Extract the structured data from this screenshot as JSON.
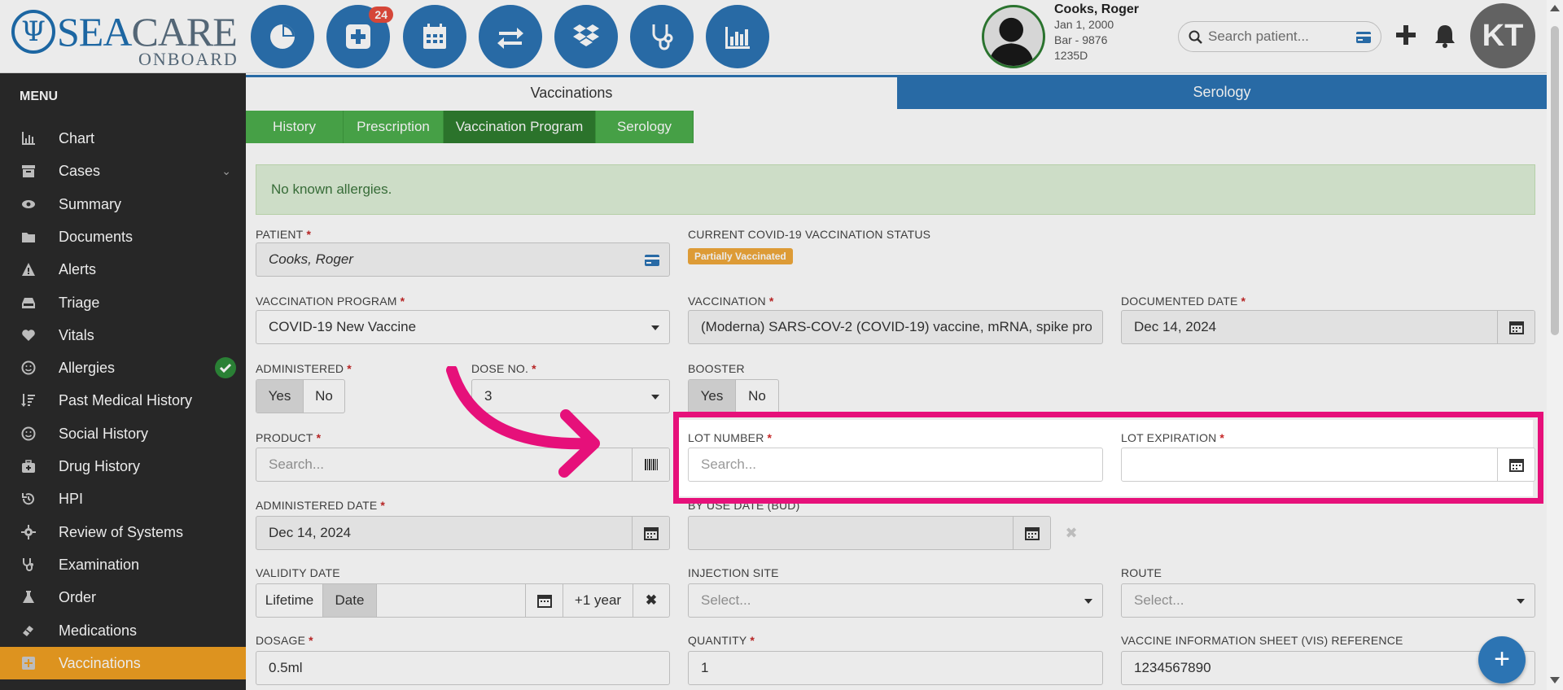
{
  "app": {
    "logo_main_a": "SEA",
    "logo_main_b": "CARE",
    "logo_sub": "ONBOARD",
    "notification_badge": "24",
    "search_placeholder": "Search patient...",
    "avatar_initials": "KT"
  },
  "patient": {
    "name": "Cooks, Roger",
    "dob": "Jan 1, 2000",
    "ident": "Bar - 9876",
    "room": "1235D"
  },
  "sidebar": {
    "title": "MENU",
    "items": [
      {
        "label": "Chart",
        "icon": "bar-chart-icon"
      },
      {
        "label": "Cases",
        "icon": "archive-icon"
      },
      {
        "label": "Summary",
        "icon": "eye-icon"
      },
      {
        "label": "Documents",
        "icon": "folder-icon"
      },
      {
        "label": "Alerts",
        "icon": "warning-icon"
      },
      {
        "label": "Triage",
        "icon": "inbox-icon"
      },
      {
        "label": "Vitals",
        "icon": "heart-icon"
      },
      {
        "label": "Allergies",
        "icon": "smile-icon"
      },
      {
        "label": "Past Medical History",
        "icon": "sort-icon"
      },
      {
        "label": "Social History",
        "icon": "smile-icon"
      },
      {
        "label": "Drug History",
        "icon": "medkit-icon"
      },
      {
        "label": "HPI",
        "icon": "history-icon"
      },
      {
        "label": "Review of Systems",
        "icon": "gear-icon"
      },
      {
        "label": "Examination",
        "icon": "stethoscope-icon"
      },
      {
        "label": "Order",
        "icon": "flask-icon"
      },
      {
        "label": "Medications",
        "icon": "pill-icon"
      },
      {
        "label": "Vaccinations",
        "icon": "plus-square-icon"
      }
    ]
  },
  "tabs": {
    "primary": [
      "Vaccinations",
      "Serology"
    ],
    "secondary": [
      "History",
      "Prescription",
      "Vaccination Program",
      "Serology"
    ]
  },
  "alert_text": "No known allergies.",
  "form": {
    "patient_label": "PATIENT",
    "patient_value": "Cooks, Roger",
    "status_label": "CURRENT COVID-19 VACCINATION STATUS",
    "status_badge": "Partially Vaccinated",
    "program_label": "VACCINATION PROGRAM",
    "program_value": "COVID-19 New Vaccine",
    "vaccination_label": "VACCINATION",
    "vaccination_value": "(Moderna) SARS-COV-2 (COVID-19) vaccine, mRNA, spike pro",
    "documented_label": "DOCUMENTED DATE",
    "documented_value": "Dec 14, 2024",
    "administered_label": "ADMINISTERED",
    "yes": "Yes",
    "no": "No",
    "dose_label": "DOSE NO.",
    "dose_value": "3",
    "booster_label": "BOOSTER",
    "product_label": "PRODUCT",
    "product_placeholder": "Search...",
    "lot_label": "LOT NUMBER",
    "lot_placeholder": "Search...",
    "lot_exp_label": "LOT EXPIRATION",
    "admin_date_label": "ADMINISTERED DATE",
    "admin_date_value": "Dec 14, 2024",
    "bud_label": "BY USE DATE (BUD)",
    "validity_label": "VALIDITY DATE",
    "lifetime": "Lifetime",
    "date": "Date",
    "plus_year": "+1 year",
    "injection_label": "INJECTION SITE",
    "injection_placeholder": "Select...",
    "route_label": "ROUTE",
    "route_placeholder": "Select...",
    "dosage_label": "DOSAGE",
    "dosage_value": "0.5ml",
    "quantity_label": "QUANTITY",
    "quantity_value": "1",
    "vis_label": "VACCINE INFORMATION SHEET (VIS) REFERENCE",
    "vis_value": "1234567890"
  },
  "colors": {
    "primary_blue": "#2c74b3",
    "green": "#4cae4c",
    "active_orange": "#f0a022",
    "highlight_pink": "#e6107a"
  }
}
